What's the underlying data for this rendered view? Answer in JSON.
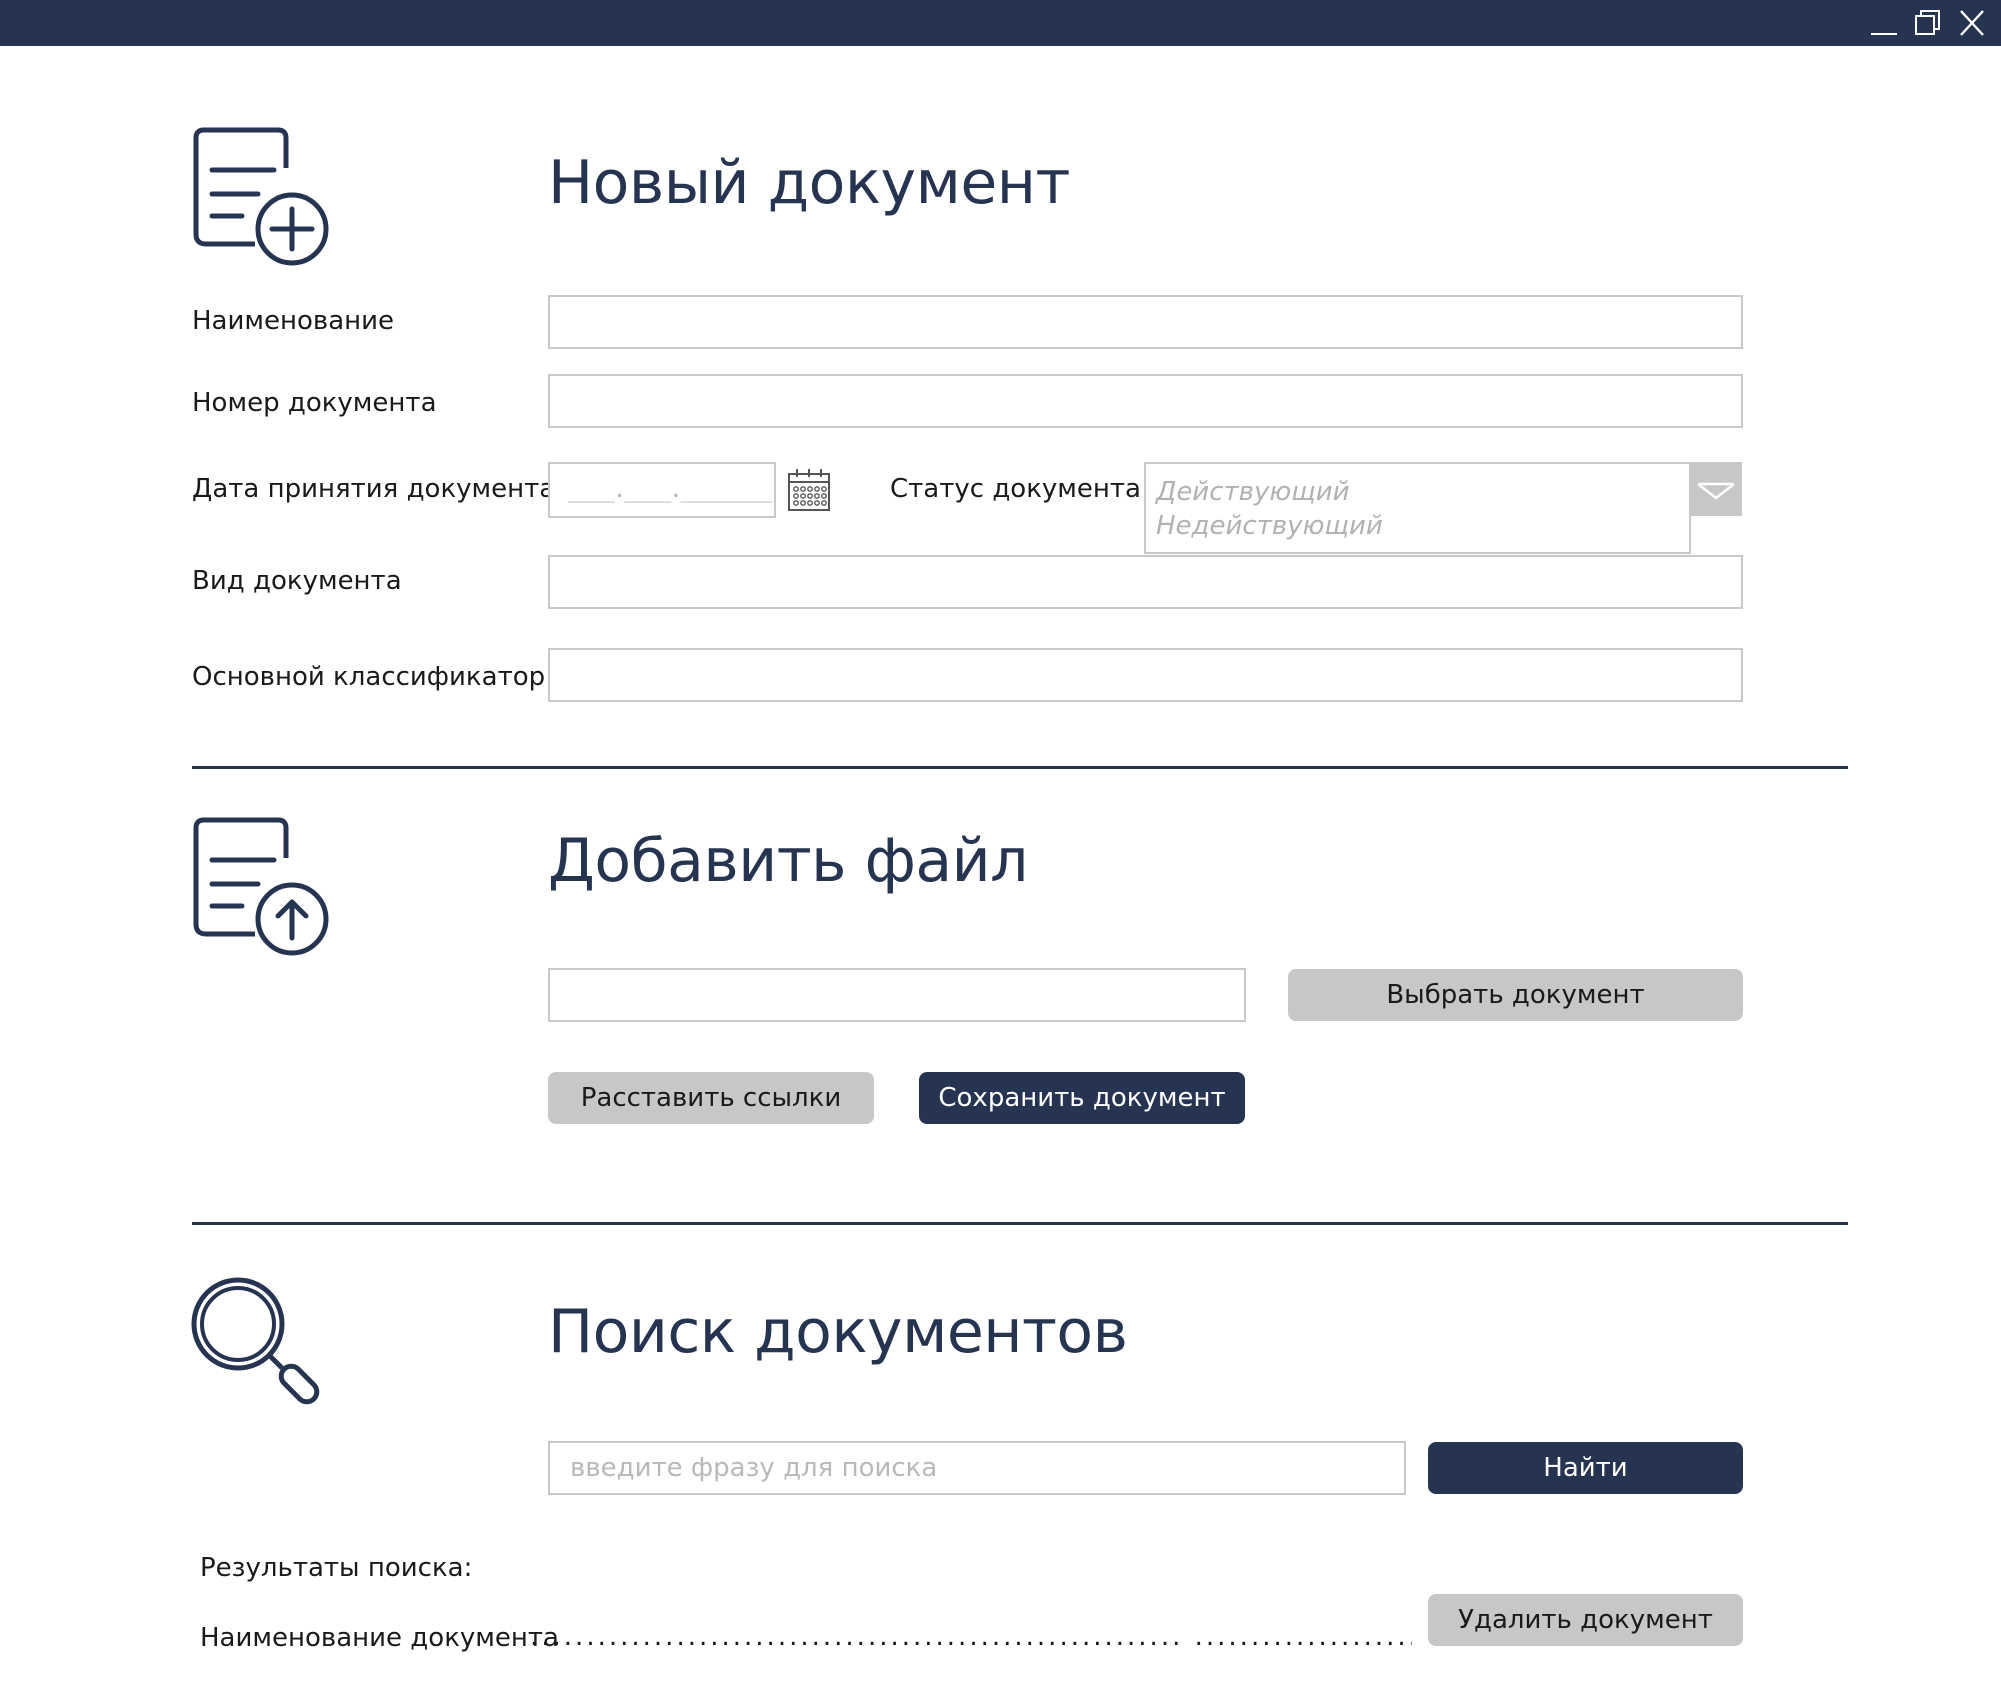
{
  "window": {
    "titlebar_color": "#263351",
    "controls": [
      "minimize-icon",
      "restore-icon",
      "close-icon"
    ]
  },
  "new_document": {
    "icon": "document-add-icon",
    "title": "Новый документ",
    "fields": {
      "name_label": "Наименование",
      "number_label": "Номер документа",
      "date_label": "Дата принятия документа",
      "date_mask": "____.____.________",
      "status_label": "Статус документа",
      "status_options": [
        "Действующий",
        "Недействующий"
      ],
      "type_label": "Вид документа",
      "classifier_label": "Основной классификатор"
    }
  },
  "add_file": {
    "icon": "document-upload-icon",
    "title": "Добавить файл",
    "choose_button": "Выбрать документ",
    "links_button": "Расставить ссылки",
    "save_button": "Сохранить документ"
  },
  "search": {
    "icon": "search-icon",
    "title": "Поиск документов",
    "placeholder": "введите фразу для поиска",
    "find_button": "Найти",
    "results_label": "Результаты поиска:",
    "result_name_label": "Наименование документа",
    "result_dots": "..........................................................  .............................",
    "delete_button": "Удалить документ"
  },
  "colors": {
    "accent": "#263351",
    "grey_button": "#c8c7c8",
    "field_border": "#c9c9c9"
  }
}
